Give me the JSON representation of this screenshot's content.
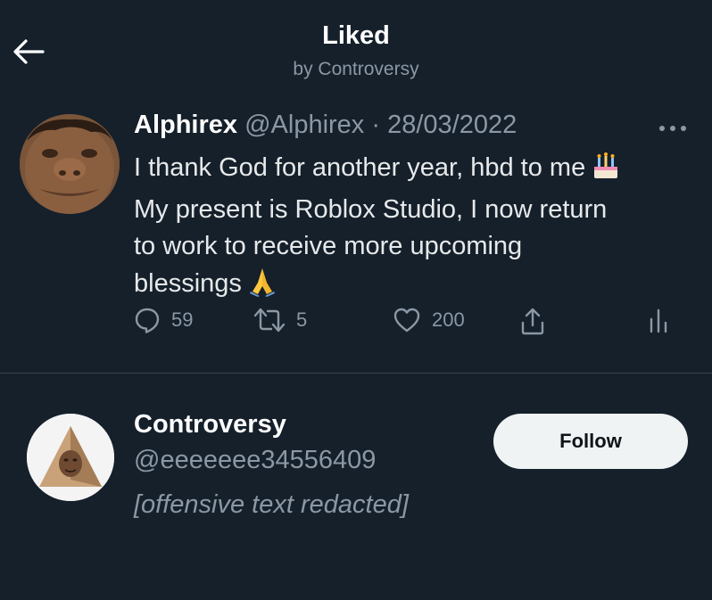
{
  "header": {
    "title": "Liked",
    "subtitle": "by Controversy",
    "back_icon": "arrow-left-icon"
  },
  "tweet": {
    "author_name": "Alphirex",
    "author_handle": "@Alphirex",
    "separator": "·",
    "date": "28/03/2022",
    "text_lines": [
      "I thank God for another year, hbd to me",
      "My present is Roblox Studio, I now return",
      "to work to receive more upcoming",
      "blessings"
    ],
    "emojis": [
      "birthday-cake-icon",
      "folded-hands-icon"
    ],
    "more_icon": "more-horizontal-icon",
    "actions": {
      "reply_count": "59",
      "retweet_count": "5",
      "like_count": "200",
      "reply_icon": "reply-icon",
      "retweet_icon": "retweet-icon",
      "like_icon": "heart-icon",
      "share_icon": "share-icon",
      "analytics_icon": "analytics-icon"
    }
  },
  "user": {
    "name": "Controversy",
    "handle": "@eeeeeee34556409",
    "bio": "[offensive text redacted]",
    "follow_label": "Follow"
  },
  "colors": {
    "background": "#15202b",
    "primary_text": "#e7e9ea",
    "secondary_text": "#8b98a5",
    "divider": "#38444d",
    "follow_button_bg": "#eff3f4"
  }
}
